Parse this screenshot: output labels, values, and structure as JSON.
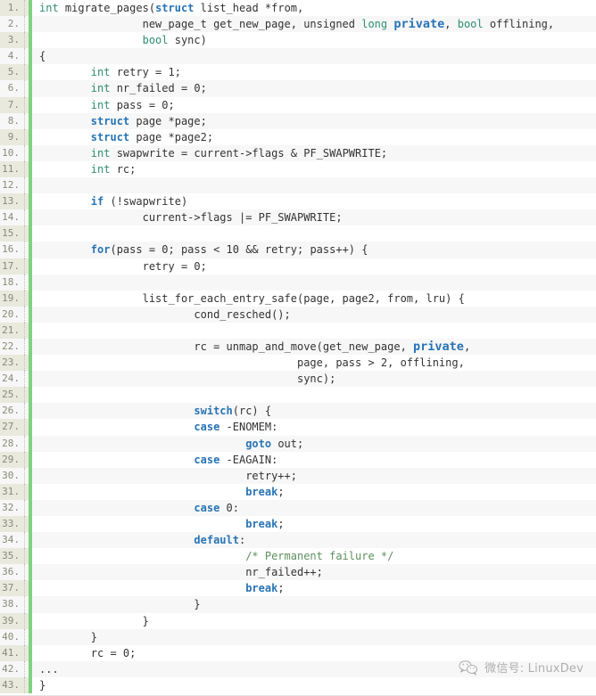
{
  "viewer": {
    "language": "c",
    "line_number_start": 1,
    "line_number_suffix": ".",
    "colors": {
      "gutter_background": "#e9e9de",
      "gutter_text": "#8a8a78",
      "accent_bar": "#7fd27f",
      "row_background": "#ffffff",
      "row_background_alt": "#f7f7f7",
      "text": "#333333",
      "type_keyword": "#2f8f74",
      "control_keyword": "#2874b5",
      "comment": "#5e8f5e"
    }
  },
  "watermark": {
    "icon": "wechat-icon",
    "text": "微信号: LinuxDev"
  },
  "code": {
    "lines": [
      {
        "n": "1.",
        "tokens": [
          {
            "t": "int",
            "c": "type"
          },
          {
            "t": " migrate_pages(",
            "c": "plain"
          },
          {
            "t": "struct",
            "c": "kw"
          },
          {
            "t": " list_head *from,",
            "c": "plain"
          }
        ]
      },
      {
        "n": "2.",
        "tokens": [
          {
            "t": "                new_page_t get_new_page, unsigned ",
            "c": "plain"
          },
          {
            "t": "long",
            "c": "type"
          },
          {
            "t": " ",
            "c": "plain"
          },
          {
            "t": "private",
            "c": "special"
          },
          {
            "t": ", ",
            "c": "plain"
          },
          {
            "t": "bool",
            "c": "type"
          },
          {
            "t": " offlining,",
            "c": "plain"
          }
        ]
      },
      {
        "n": "3.",
        "tokens": [
          {
            "t": "                ",
            "c": "plain"
          },
          {
            "t": "bool",
            "c": "type"
          },
          {
            "t": " sync)",
            "c": "plain"
          }
        ]
      },
      {
        "n": "4.",
        "tokens": [
          {
            "t": "{",
            "c": "plain"
          }
        ]
      },
      {
        "n": "5.",
        "tokens": [
          {
            "t": "        ",
            "c": "plain"
          },
          {
            "t": "int",
            "c": "type"
          },
          {
            "t": " retry = 1;",
            "c": "plain"
          }
        ]
      },
      {
        "n": "6.",
        "tokens": [
          {
            "t": "        ",
            "c": "plain"
          },
          {
            "t": "int",
            "c": "type"
          },
          {
            "t": " nr_failed = 0;",
            "c": "plain"
          }
        ]
      },
      {
        "n": "7.",
        "tokens": [
          {
            "t": "        ",
            "c": "plain"
          },
          {
            "t": "int",
            "c": "type"
          },
          {
            "t": " pass = 0;",
            "c": "plain"
          }
        ]
      },
      {
        "n": "8.",
        "tokens": [
          {
            "t": "        ",
            "c": "plain"
          },
          {
            "t": "struct",
            "c": "kw"
          },
          {
            "t": " page *page;",
            "c": "plain"
          }
        ]
      },
      {
        "n": "9.",
        "tokens": [
          {
            "t": "        ",
            "c": "plain"
          },
          {
            "t": "struct",
            "c": "kw"
          },
          {
            "t": " page *page2;",
            "c": "plain"
          }
        ]
      },
      {
        "n": "10.",
        "tokens": [
          {
            "t": "        ",
            "c": "plain"
          },
          {
            "t": "int",
            "c": "type"
          },
          {
            "t": " swapwrite = current->flags & PF_SWAPWRITE;",
            "c": "plain"
          }
        ]
      },
      {
        "n": "11.",
        "tokens": [
          {
            "t": "        ",
            "c": "plain"
          },
          {
            "t": "int",
            "c": "type"
          },
          {
            "t": " rc;",
            "c": "plain"
          }
        ]
      },
      {
        "n": "12.",
        "tokens": [
          {
            "t": "",
            "c": "plain"
          }
        ]
      },
      {
        "n": "13.",
        "tokens": [
          {
            "t": "        ",
            "c": "plain"
          },
          {
            "t": "if",
            "c": "kw"
          },
          {
            "t": " (!swapwrite)",
            "c": "plain"
          }
        ]
      },
      {
        "n": "14.",
        "tokens": [
          {
            "t": "                current->flags |= PF_SWAPWRITE;",
            "c": "plain"
          }
        ]
      },
      {
        "n": "15.",
        "tokens": [
          {
            "t": "",
            "c": "plain"
          }
        ]
      },
      {
        "n": "16.",
        "tokens": [
          {
            "t": "        ",
            "c": "plain"
          },
          {
            "t": "for",
            "c": "kw"
          },
          {
            "t": "(pass = 0; pass < 10 && retry; pass++) {",
            "c": "plain"
          }
        ]
      },
      {
        "n": "17.",
        "tokens": [
          {
            "t": "                retry = 0;",
            "c": "plain"
          }
        ]
      },
      {
        "n": "18.",
        "tokens": [
          {
            "t": "",
            "c": "plain"
          }
        ]
      },
      {
        "n": "19.",
        "tokens": [
          {
            "t": "                list_for_each_entry_safe(page, page2, from, lru) {",
            "c": "plain"
          }
        ]
      },
      {
        "n": "20.",
        "tokens": [
          {
            "t": "                        cond_resched();",
            "c": "plain"
          }
        ]
      },
      {
        "n": "21.",
        "tokens": [
          {
            "t": "",
            "c": "plain"
          }
        ]
      },
      {
        "n": "22.",
        "tokens": [
          {
            "t": "                        rc = unmap_and_move(get_new_page, ",
            "c": "plain"
          },
          {
            "t": "private",
            "c": "special"
          },
          {
            "t": ",",
            "c": "plain"
          }
        ]
      },
      {
        "n": "23.",
        "tokens": [
          {
            "t": "                                        page, pass > 2, offlining,",
            "c": "plain"
          }
        ]
      },
      {
        "n": "24.",
        "tokens": [
          {
            "t": "                                        sync);",
            "c": "plain"
          }
        ]
      },
      {
        "n": "25.",
        "tokens": [
          {
            "t": "",
            "c": "plain"
          }
        ]
      },
      {
        "n": "26.",
        "tokens": [
          {
            "t": "                        ",
            "c": "plain"
          },
          {
            "t": "switch",
            "c": "kw"
          },
          {
            "t": "(rc) {",
            "c": "plain"
          }
        ]
      },
      {
        "n": "27.",
        "tokens": [
          {
            "t": "                        ",
            "c": "plain"
          },
          {
            "t": "case",
            "c": "kw"
          },
          {
            "t": " -ENOMEM:",
            "c": "plain"
          }
        ]
      },
      {
        "n": "28.",
        "tokens": [
          {
            "t": "                                ",
            "c": "plain"
          },
          {
            "t": "goto",
            "c": "kw"
          },
          {
            "t": " out;",
            "c": "plain"
          }
        ]
      },
      {
        "n": "29.",
        "tokens": [
          {
            "t": "                        ",
            "c": "plain"
          },
          {
            "t": "case",
            "c": "kw"
          },
          {
            "t": " -EAGAIN:",
            "c": "plain"
          }
        ]
      },
      {
        "n": "30.",
        "tokens": [
          {
            "t": "                                retry++;",
            "c": "plain"
          }
        ]
      },
      {
        "n": "31.",
        "tokens": [
          {
            "t": "                                ",
            "c": "plain"
          },
          {
            "t": "break",
            "c": "kw"
          },
          {
            "t": ";",
            "c": "plain"
          }
        ]
      },
      {
        "n": "32.",
        "tokens": [
          {
            "t": "                        ",
            "c": "plain"
          },
          {
            "t": "case",
            "c": "kw"
          },
          {
            "t": " 0:",
            "c": "plain"
          }
        ]
      },
      {
        "n": "33.",
        "tokens": [
          {
            "t": "                                ",
            "c": "plain"
          },
          {
            "t": "break",
            "c": "kw"
          },
          {
            "t": ";",
            "c": "plain"
          }
        ]
      },
      {
        "n": "34.",
        "tokens": [
          {
            "t": "                        ",
            "c": "plain"
          },
          {
            "t": "default",
            "c": "kw"
          },
          {
            "t": ":",
            "c": "plain"
          }
        ]
      },
      {
        "n": "35.",
        "tokens": [
          {
            "t": "                                ",
            "c": "plain"
          },
          {
            "t": "/* Permanent failure */",
            "c": "comment"
          }
        ]
      },
      {
        "n": "36.",
        "tokens": [
          {
            "t": "                                nr_failed++;",
            "c": "plain"
          }
        ]
      },
      {
        "n": "37.",
        "tokens": [
          {
            "t": "                                ",
            "c": "plain"
          },
          {
            "t": "break",
            "c": "kw"
          },
          {
            "t": ";",
            "c": "plain"
          }
        ]
      },
      {
        "n": "38.",
        "tokens": [
          {
            "t": "                        }",
            "c": "plain"
          }
        ]
      },
      {
        "n": "39.",
        "tokens": [
          {
            "t": "                }",
            "c": "plain"
          }
        ]
      },
      {
        "n": "40.",
        "tokens": [
          {
            "t": "        }",
            "c": "plain"
          }
        ]
      },
      {
        "n": "41.",
        "tokens": [
          {
            "t": "        rc = 0;",
            "c": "plain"
          }
        ]
      },
      {
        "n": "42.",
        "tokens": [
          {
            "t": "...",
            "c": "plain"
          }
        ]
      },
      {
        "n": "43.",
        "tokens": [
          {
            "t": "}",
            "c": "plain"
          }
        ]
      }
    ]
  }
}
